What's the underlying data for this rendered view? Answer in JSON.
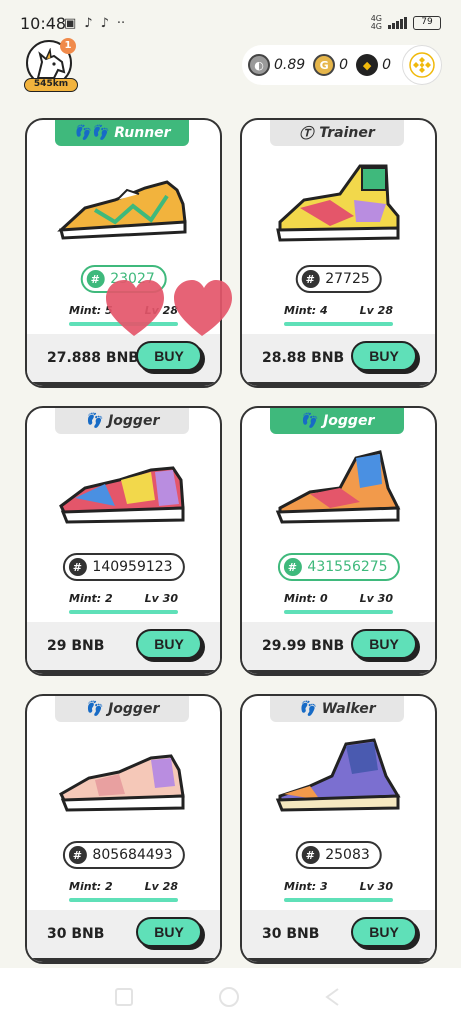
{
  "status_bar": {
    "time": "10:48",
    "network": "4G",
    "network_sub": "4G",
    "battery": "79",
    "app_icons": [
      "calendar-icon",
      "tiktok-icon",
      "tiktok-icon",
      "more-icon"
    ]
  },
  "header": {
    "badge_count": "1",
    "distance": "545km",
    "balances": [
      {
        "token": "GST",
        "icon": "gst-coin-icon",
        "value": "0.89"
      },
      {
        "token": "GMT",
        "icon": "gmt-coin-icon",
        "value": "0"
      },
      {
        "token": "BNB",
        "icon": "bnb-coin-icon",
        "value": "0"
      }
    ]
  },
  "cards": [
    {
      "type": "Runner",
      "tab_style": "green",
      "id": "23027",
      "id_style": "green",
      "mint": "Mint: 5",
      "level": "Lv 28",
      "price": "27.888 BNB",
      "buy": "BUY"
    },
    {
      "type": "Trainer",
      "tab_style": "grey",
      "id": "27725",
      "id_style": "dark",
      "mint": "Mint: 4",
      "level": "Lv 28",
      "price": "28.88 BNB",
      "buy": "BUY"
    },
    {
      "type": "Jogger",
      "tab_style": "grey",
      "id": "140959123",
      "id_style": "dark",
      "mint": "Mint: 2",
      "level": "Lv 30",
      "price": "29 BNB",
      "buy": "BUY"
    },
    {
      "type": "Jogger",
      "tab_style": "green",
      "id": "431556275",
      "id_style": "green",
      "mint": "Mint: 0",
      "level": "Lv 30",
      "price": "29.99 BNB",
      "buy": "BUY"
    },
    {
      "type": "Jogger",
      "tab_style": "grey",
      "id": "805684493",
      "id_style": "dark",
      "mint": "Mint: 2",
      "level": "Lv 28",
      "price": "30 BNB",
      "buy": "BUY"
    },
    {
      "type": "Walker",
      "tab_style": "grey",
      "id": "25083",
      "id_style": "dark",
      "mint": "Mint: 3",
      "level": "Lv 30",
      "price": "30 BNB",
      "buy": "BUY"
    }
  ],
  "colors": {
    "accent": "#5fe0b8",
    "tab_green": "#3fb97c",
    "background": "#f5f5ef"
  }
}
